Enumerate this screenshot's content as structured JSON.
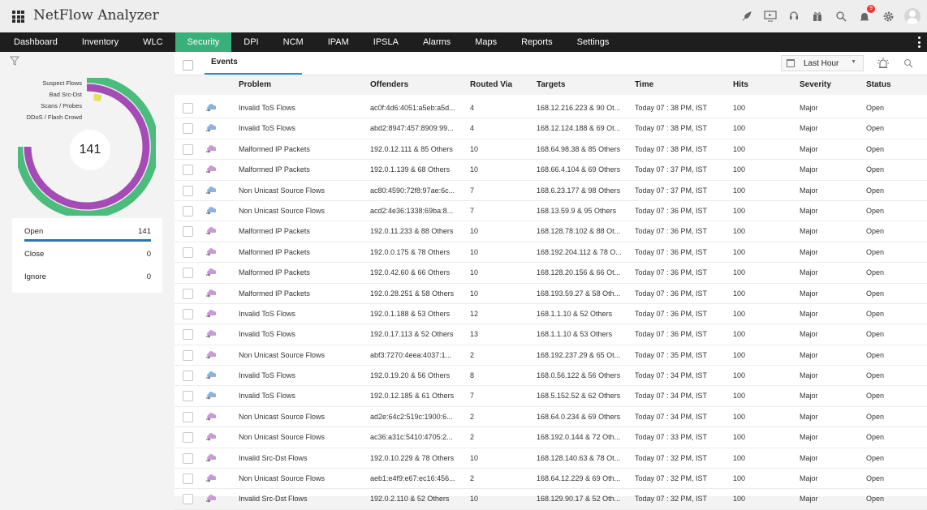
{
  "app": {
    "title": "NetFlow Analyzer"
  },
  "nav": [
    {
      "label": "Dashboard",
      "active": false
    },
    {
      "label": "Inventory",
      "active": false
    },
    {
      "label": "WLC",
      "active": false
    },
    {
      "label": "Security",
      "active": true
    },
    {
      "label": "DPI",
      "active": false
    },
    {
      "label": "NCM",
      "active": false
    },
    {
      "label": "IPAM",
      "active": false
    },
    {
      "label": "IPSLA",
      "active": false
    },
    {
      "label": "Alarms",
      "active": false
    },
    {
      "label": "Maps",
      "active": false
    },
    {
      "label": "Reports",
      "active": false
    },
    {
      "label": "Settings",
      "active": false
    }
  ],
  "top_icons": [
    "rocket-icon",
    "monitor-icon",
    "headset-icon",
    "gift-icon",
    "search-icon",
    "bell-icon",
    "gear-icon",
    "avatar-icon"
  ],
  "notification_count": "9",
  "summary": {
    "legend": [
      "Suspect Flows",
      "Bad Src-Dst",
      "Scans / Probes",
      "DDoS / Flash Crowd"
    ],
    "total": "141",
    "colors": {
      "suspect": "#4cbc7d",
      "badsrc": "#a54bb5",
      "scans": "#e6e055"
    },
    "status": [
      {
        "label": "Open",
        "count": "141"
      },
      {
        "label": "Close",
        "count": "0"
      },
      {
        "label": "Ignore",
        "count": "0"
      }
    ]
  },
  "events": {
    "tab_label": "Events",
    "time_range": "Last Hour",
    "columns": [
      "Problem",
      "Offenders",
      "Routed Via",
      "Targets",
      "Time",
      "Hits",
      "Severity",
      "Status"
    ],
    "rows": [
      {
        "icon": "blue",
        "problem": "Invalid ToS Flows",
        "offenders": "ac0f:4d6:4051:a5eb:a5d...",
        "via": "4",
        "targets": "168.12.216.223 & 90 Ot...",
        "time": "Today 07 : 38 PM, IST",
        "hits": "100",
        "severity": "Major",
        "status": "Open"
      },
      {
        "icon": "blue",
        "problem": "Invalid ToS Flows",
        "offenders": "abd2:8947:457:8909:99...",
        "via": "4",
        "targets": "168.12.124.188 & 69 Ot...",
        "time": "Today 07 : 38 PM, IST",
        "hits": "100",
        "severity": "Major",
        "status": "Open"
      },
      {
        "icon": "purple",
        "problem": "Malformed IP Packets",
        "offenders": "192.0.12.111 & 85 Others",
        "via": "10",
        "targets": "168.64.98.38 & 85 Others",
        "time": "Today 07 : 38 PM, IST",
        "hits": "100",
        "severity": "Major",
        "status": "Open"
      },
      {
        "icon": "purple",
        "problem": "Malformed IP Packets",
        "offenders": "192.0.1.139 & 68 Others",
        "via": "10",
        "targets": "168.66.4.104 & 69 Others",
        "time": "Today 07 : 37 PM, IST",
        "hits": "100",
        "severity": "Major",
        "status": "Open"
      },
      {
        "icon": "blue",
        "problem": "Non Unicast Source Flows",
        "offenders": "ac80:4590:72f8:97ae:6c...",
        "via": "7",
        "targets": "168.6.23.177 & 98 Others",
        "time": "Today 07 : 37 PM, IST",
        "hits": "100",
        "severity": "Major",
        "status": "Open"
      },
      {
        "icon": "blue",
        "problem": "Non Unicast Source Flows",
        "offenders": "acd2:4e36:1338:69ba:8...",
        "via": "7",
        "targets": "168.13.59.9 & 95 Others",
        "time": "Today 07 : 36 PM, IST",
        "hits": "100",
        "severity": "Major",
        "status": "Open"
      },
      {
        "icon": "purple",
        "problem": "Malformed IP Packets",
        "offenders": "192.0.11.233 & 88 Others",
        "via": "10",
        "targets": "168.128.78.102 & 88 Ot...",
        "time": "Today 07 : 36 PM, IST",
        "hits": "100",
        "severity": "Major",
        "status": "Open"
      },
      {
        "icon": "purple",
        "problem": "Malformed IP Packets",
        "offenders": "192.0.0.175 & 78 Others",
        "via": "10",
        "targets": "168.192.204.112 & 78 O...",
        "time": "Today 07 : 36 PM, IST",
        "hits": "100",
        "severity": "Major",
        "status": "Open"
      },
      {
        "icon": "purple",
        "problem": "Malformed IP Packets",
        "offenders": "192.0.42.60 & 66 Others",
        "via": "10",
        "targets": "168.128.20.156 & 66 Ot...",
        "time": "Today 07 : 36 PM, IST",
        "hits": "100",
        "severity": "Major",
        "status": "Open"
      },
      {
        "icon": "purple",
        "problem": "Malformed IP Packets",
        "offenders": "192.0.28.251 & 58 Others",
        "via": "10",
        "targets": "168.193.59.27 & 58 Oth...",
        "time": "Today 07 : 36 PM, IST",
        "hits": "100",
        "severity": "Major",
        "status": "Open"
      },
      {
        "icon": "purple",
        "problem": "Invalid ToS Flows",
        "offenders": "192.0.1.188 & 53 Others",
        "via": "12",
        "targets": "168.1.1.10 & 52 Others",
        "time": "Today 07 : 36 PM, IST",
        "hits": "100",
        "severity": "Major",
        "status": "Open"
      },
      {
        "icon": "purple",
        "problem": "Invalid ToS Flows",
        "offenders": "192.0.17.113 & 52 Others",
        "via": "13",
        "targets": "168.1.1.10 & 53 Others",
        "time": "Today 07 : 36 PM, IST",
        "hits": "100",
        "severity": "Major",
        "status": "Open"
      },
      {
        "icon": "purple",
        "problem": "Non Unicast Source Flows",
        "offenders": "abf3:7270:4eea:4037:1...",
        "via": "2",
        "targets": "168.192.237.29 & 65 Ot...",
        "time": "Today 07 : 35 PM, IST",
        "hits": "100",
        "severity": "Major",
        "status": "Open"
      },
      {
        "icon": "blue",
        "problem": "Invalid ToS Flows",
        "offenders": "192.0.19.20 & 56 Others",
        "via": "8",
        "targets": "168.0.56.122 & 56 Others",
        "time": "Today 07 : 34 PM, IST",
        "hits": "100",
        "severity": "Major",
        "status": "Open"
      },
      {
        "icon": "blue",
        "problem": "Invalid ToS Flows",
        "offenders": "192.0.12.185 & 61 Others",
        "via": "7",
        "targets": "168.5.152.52 & 62 Others",
        "time": "Today 07 : 34 PM, IST",
        "hits": "100",
        "severity": "Major",
        "status": "Open"
      },
      {
        "icon": "purple",
        "problem": "Non Unicast Source Flows",
        "offenders": "ad2e:64c2:519c:1900:6...",
        "via": "2",
        "targets": "168.64.0.234 & 69 Others",
        "time": "Today 07 : 34 PM, IST",
        "hits": "100",
        "severity": "Major",
        "status": "Open"
      },
      {
        "icon": "purple",
        "problem": "Non Unicast Source Flows",
        "offenders": "ac36:a31c:5410:4705:2...",
        "via": "2",
        "targets": "168.192.0.144 & 72 Oth...",
        "time": "Today 07 : 33 PM, IST",
        "hits": "100",
        "severity": "Major",
        "status": "Open"
      },
      {
        "icon": "purple",
        "problem": "Invalid Src-Dst Flows",
        "offenders": "192.0.10.229 & 78 Others",
        "via": "10",
        "targets": "168.128.140.63 & 78 Ot...",
        "time": "Today 07 : 32 PM, IST",
        "hits": "100",
        "severity": "Major",
        "status": "Open"
      },
      {
        "icon": "purple",
        "problem": "Non Unicast Source Flows",
        "offenders": "aeb1:e4f9:e67:ec16:456...",
        "via": "2",
        "targets": "168.64.12.229 & 69 Oth...",
        "time": "Today 07 : 32 PM, IST",
        "hits": "100",
        "severity": "Major",
        "status": "Open"
      },
      {
        "icon": "purple",
        "problem": "Invalid Src-Dst Flows",
        "offenders": "192.0.2.110 & 52 Others",
        "via": "10",
        "targets": "168.129.90.17 & 52 Oth...",
        "time": "Today 07 : 32 PM, IST",
        "hits": "100",
        "severity": "Major",
        "status": "Open"
      }
    ]
  }
}
